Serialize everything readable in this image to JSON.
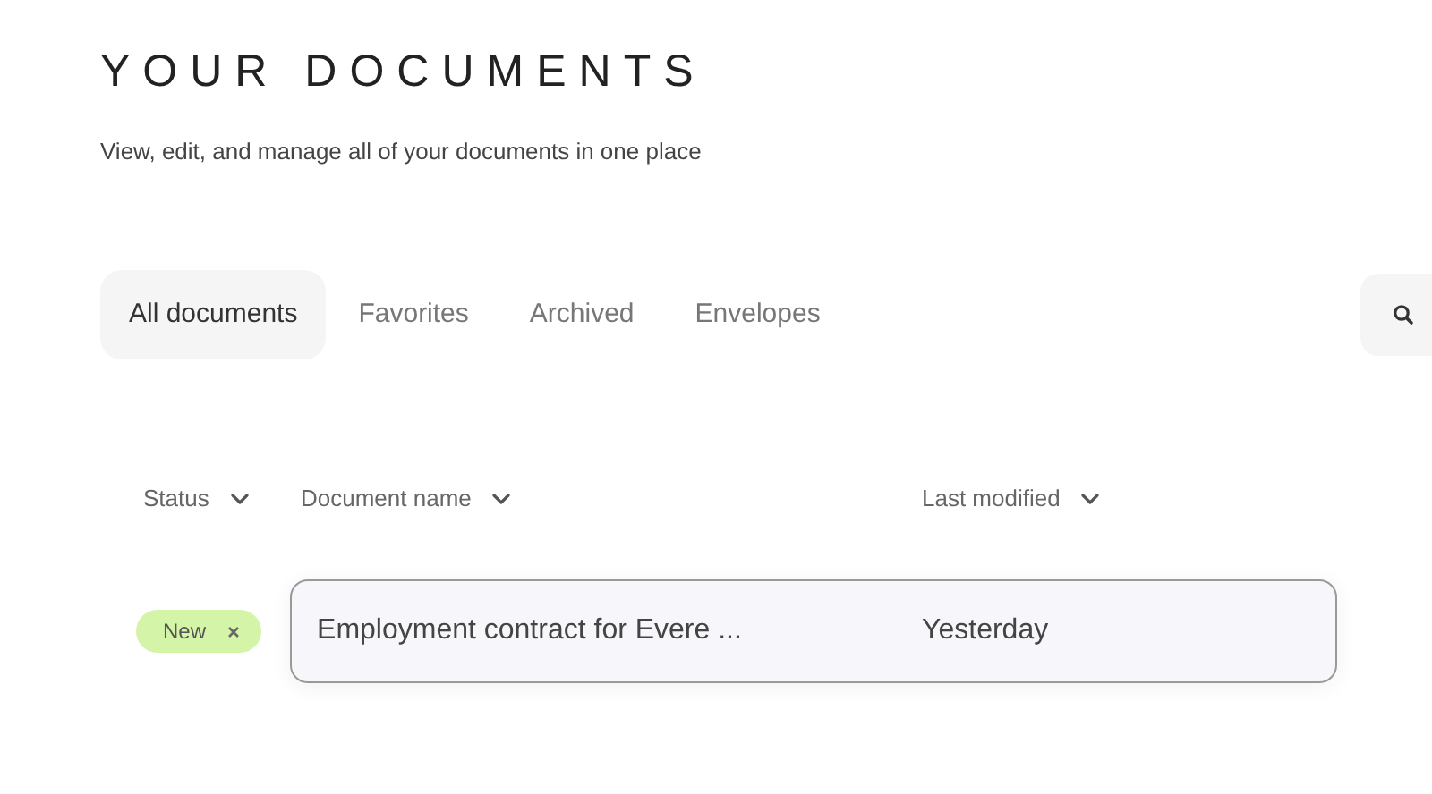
{
  "header": {
    "title": "YOUR DOCUMENTS",
    "subtitle": "View, edit, and manage all of your documents in one place"
  },
  "tabs": [
    {
      "label": "All documents",
      "selected": true
    },
    {
      "label": "Favorites",
      "selected": false
    },
    {
      "label": "Archived",
      "selected": false
    },
    {
      "label": "Envelopes",
      "selected": false
    }
  ],
  "table": {
    "columns": [
      "Status",
      "Document name",
      "Last modified"
    ],
    "rows": [
      {
        "status": "New",
        "color": "#d4f5a8",
        "name": "Employment contract for Evere ...",
        "modified": "Yesterday"
      }
    ]
  }
}
